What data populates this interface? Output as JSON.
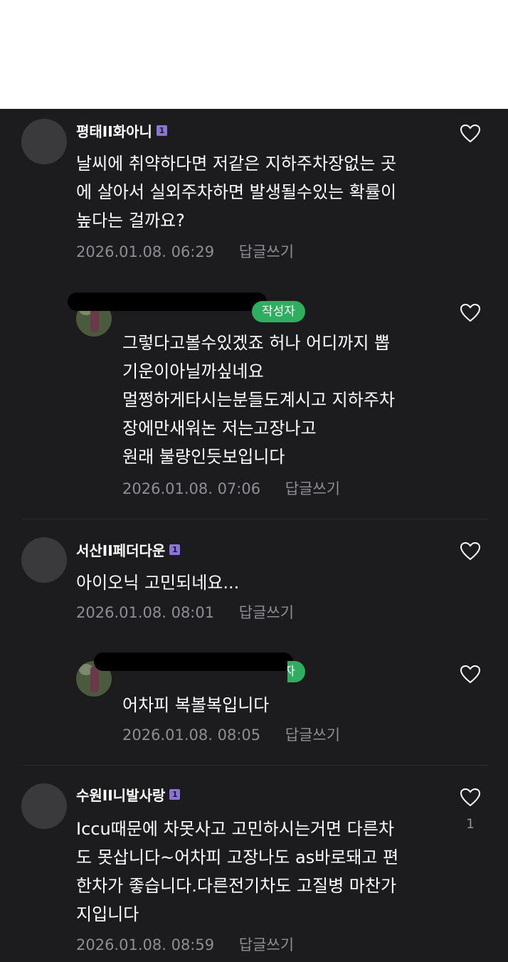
{
  "comments": [
    {
      "author": "평태II화아니",
      "badge": "1",
      "lines": [
        "날씨에 취약하다면 저같은 지하주차장없는 곳",
        "에 살아서 실외주차하면 발생될수있는 확률이",
        "높다는 걸까요?"
      ],
      "date": "2026.01.08. 06:29",
      "reply_label": "답글쓰기"
    },
    {
      "author_tag": "작성자",
      "lines": [
        "그렇다고볼수있겠죠 허나 어디까지 뽑",
        "기운이아닐까싶네요",
        "멀쩡하게타시는분들도계시고 지하주차",
        "장에만새워논 저는고장나고",
        "원래 불량인듯보입니다"
      ],
      "date": "2026.01.08. 07:06",
      "reply_label": "답글쓰기"
    },
    {
      "author": "서산II페더다운",
      "badge": "1",
      "lines": [
        "아이오닉 고민되네요..."
      ],
      "date": "2026.01.08. 08:01",
      "reply_label": "답글쓰기"
    },
    {
      "author_tag": "작성자",
      "lines": [
        "어차피 복볼복입니다"
      ],
      "date": "2026.01.08. 08:05",
      "reply_label": "답글쓰기"
    },
    {
      "author": "수원II니발사랑",
      "badge": "1",
      "lines": [
        "Iccu때문에 차못사고 고민하시는거면 다른차",
        "도 못삽니다~어차피 고장나도 as바로돼고 편",
        "한차가 좋습니다.다른전기차도 고질병 마찬가",
        "지입니다"
      ],
      "date": "2026.01.08. 08:59",
      "reply_label": "답글쓰기",
      "like_count": "1"
    }
  ],
  "icons": {
    "like": "heart-outline-icon",
    "avatar": "default-avatar-icon",
    "badge": "level-badge-icon"
  },
  "colors": {
    "background": "#1c1c1e",
    "text": "#ffffff",
    "meta": "#8e8e93",
    "author_tag": "#2fae5f",
    "badge": "#8a74d6"
  }
}
